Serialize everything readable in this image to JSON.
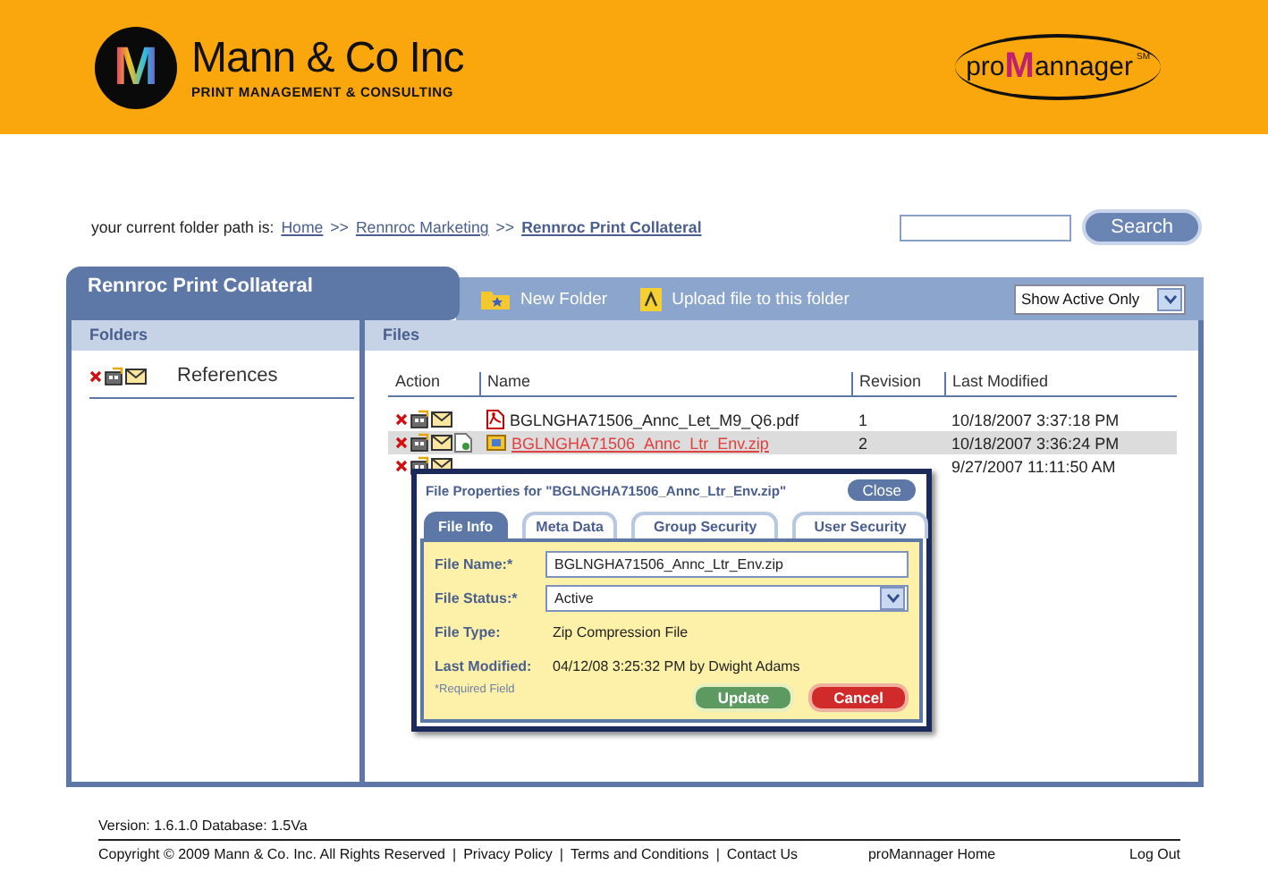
{
  "header": {
    "company_logo_letter": "M",
    "company_name": "Mann & Co Inc",
    "tagline": "PRINT MANAGEMENT & CONSULTING",
    "product_logo": [
      "pro",
      "M",
      "annager"
    ],
    "product_mark": "SM"
  },
  "breadcrumb": {
    "label": "your current folder path is:",
    "items": [
      {
        "text": "Home",
        "current": false
      },
      {
        "text": "Rennroc Marketing",
        "current": false
      },
      {
        "text": "Rennroc Print Collateral",
        "current": true
      }
    ],
    "separator": ">>"
  },
  "search": {
    "button": "Search"
  },
  "panel": {
    "title": "Rennroc Print Collateral",
    "toolbar": [
      "New Folder",
      "Upload file to this folder"
    ],
    "filter": "Show Active Only"
  },
  "folders": {
    "heading": "Folders",
    "items": [
      {
        "name": "References"
      }
    ]
  },
  "files": {
    "heading": "Files",
    "columns": [
      "Action",
      "Name",
      "Revision",
      "Last Modified"
    ],
    "rows": [
      {
        "kind": "pdf",
        "name": "BGLNGHA71506_Annc_Let_M9_Q6.pdf",
        "revision": "1",
        "modified": "10/18/2007 3:37:18 PM",
        "selected": false,
        "extra_action": false
      },
      {
        "kind": "zip",
        "name": "BGLNGHA71506_Annc_Ltr_Env.zip",
        "revision": "2",
        "modified": "10/18/2007 3:36:24 PM",
        "selected": true,
        "extra_action": true
      },
      {
        "kind": "covered",
        "modified": "9/27/2007 11:11:50 AM",
        "selected": false,
        "extra_action": false
      }
    ]
  },
  "dialog": {
    "title": "File Properties for \"BGLNGHA71506_Annc_Ltr_Env.zip\"",
    "close": "Close",
    "tabs": [
      {
        "label": "File Info",
        "selected": true
      },
      {
        "label": "Meta Data",
        "selected": false
      },
      {
        "label": "Group Security",
        "selected": false
      },
      {
        "label": "User Security",
        "selected": false
      }
    ],
    "fields": [
      {
        "kind": "input",
        "label": "File Name:*",
        "value": "BGLNGHA71506_Annc_Ltr_Env.zip"
      },
      {
        "kind": "select",
        "label": "File Status:*",
        "value": "Active"
      },
      {
        "kind": "text",
        "label": "File Type:",
        "value": "Zip Compression File"
      },
      {
        "kind": "text",
        "label": "Last Modified:",
        "value": "04/12/08  3:25:32 PM  by Dwight Adams"
      }
    ],
    "note": "*Required Field",
    "buttons": [
      {
        "kind": "primary",
        "label": "Update"
      },
      {
        "kind": "danger",
        "label": "Cancel"
      }
    ]
  },
  "footer": {
    "version": "Version: 1.6.1.0 Database: 1.5Va",
    "copyright": "Copyright © 2009 Mann & Co. Inc. All Rights Reserved",
    "links": [
      "Privacy Policy",
      "Terms and Conditions",
      "Contact Us"
    ],
    "separator": "|",
    "home": "proMannager Home",
    "logout": "Log Out"
  }
}
